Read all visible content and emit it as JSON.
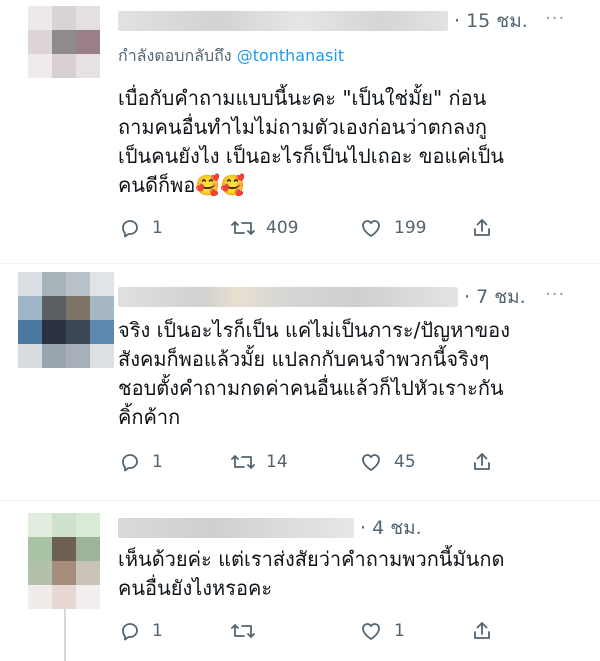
{
  "tweets": [
    {
      "time": "· 15 ชม.",
      "reply_to_prefix": "กำลังตอบกลับถึง ",
      "reply_to_handle": "@tonthanasit",
      "lines": [
        "เบื่อกับคำถามแบบนี้นะคะ  \"เป็นใช่มั้ย\" ก่อน",
        "ถามคนอื่นทำไมไม่ถามตัวเองก่อนว่าตกลงกู",
        "เป็นคนยังไง เป็นอะไรก็เป็นไปเถอะ ขอแค่เป็น",
        "คนดีก็พอ🥰🥰"
      ],
      "replies": "1",
      "retweets": "409",
      "likes": "199"
    },
    {
      "time": "· 7 ชม.",
      "lines": [
        "จริง เป็นอะไรก็เป็น แค่ไม่เป็นภาระ/ปัญหาของ",
        "สังคมก็พอแล้วมั้ย แปลกกับคนจำพวกนี้จริงๆ",
        "ชอบตั้งคำถามกดค่าคนอื่นแล้วก็ไปหัวเราะกัน",
        "คิ้กค้าก"
      ],
      "replies": "1",
      "retweets": "14",
      "likes": "45"
    },
    {
      "time": "· 4 ชม.",
      "lines": [
        "เห็นด้วยค่ะ แต่เราส่งสัยว่าคำถามพวกนี้มันกด",
        "คนอื่นยังไงหรอคะ"
      ],
      "replies": "1",
      "retweets": "",
      "likes": "1"
    }
  ],
  "icons": {
    "reply": "reply-icon",
    "retweet": "retweet-icon",
    "like": "heart-icon",
    "share": "share-icon",
    "more": "more-icon"
  },
  "colors": {
    "text": "#0f1419",
    "secondary": "#536471",
    "link": "#1d9bf0",
    "divider": "#eff3f4"
  }
}
